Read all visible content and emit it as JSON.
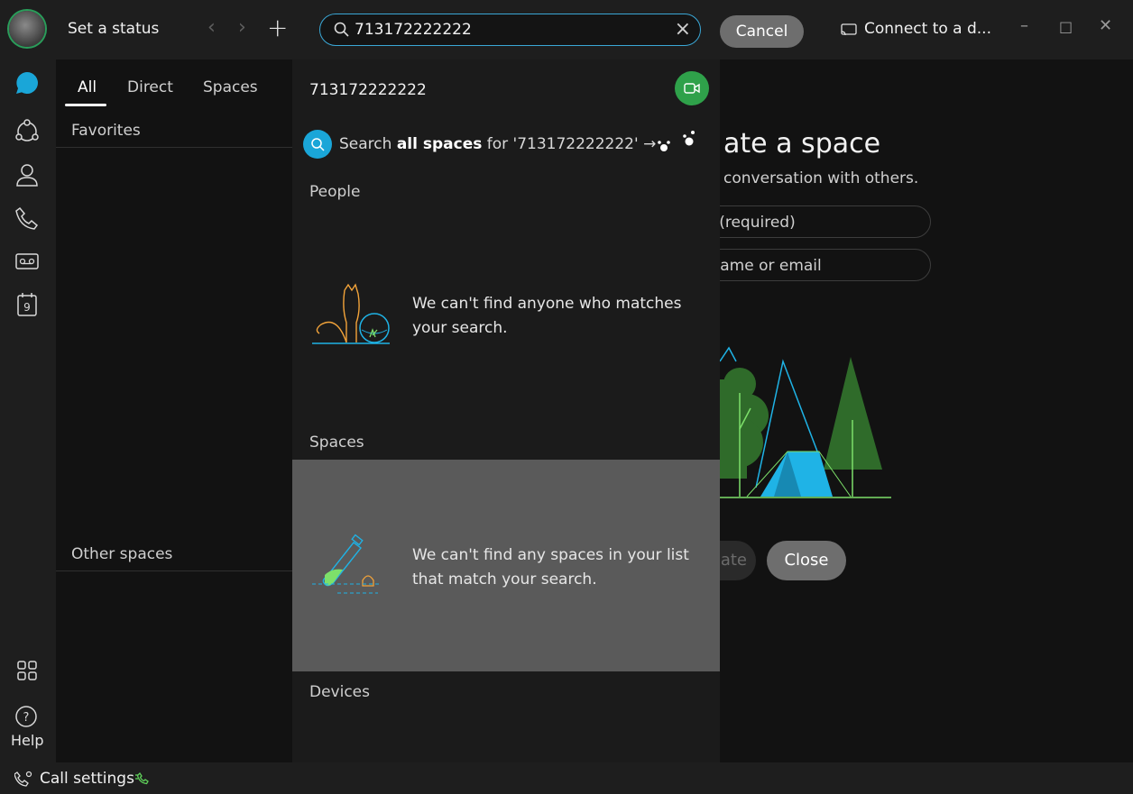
{
  "topbar": {
    "status_label": "Set a status",
    "search_value": "713172222222",
    "cancel_label": "Cancel",
    "connect_label": "Connect to a d...",
    "icons": [
      "back-icon",
      "forward-icon",
      "plus-icon",
      "search-icon",
      "clear-icon",
      "cast-icon",
      "minimize-icon",
      "maximize-icon",
      "close-icon"
    ]
  },
  "rail": {
    "help_label": "Help",
    "calendar_day": "9",
    "icons": [
      "messaging-icon",
      "teams-icon",
      "contacts-icon",
      "calls-icon",
      "voicemail-icon",
      "calendar-icon",
      "apps-icon",
      "help-icon"
    ]
  },
  "listpane": {
    "tabs": [
      {
        "label": "All"
      },
      {
        "label": "Direct"
      },
      {
        "label": "Spaces"
      }
    ],
    "favorites_label": "Favorites",
    "other_spaces_label": "Other spaces"
  },
  "dropdown": {
    "query": "713172222222",
    "search_all_prefix": "Search ",
    "search_all_bold": "all spaces",
    "search_all_suffix": " for '713172222222' →",
    "people_heading": "People",
    "people_empty": "We can't find anyone who matches your search.",
    "spaces_heading": "Spaces",
    "spaces_empty": "We can't find any spaces in your list that match your search.",
    "devices_heading": "Devices"
  },
  "main": {
    "title": "ate a space",
    "subtitle": "conversation with others.",
    "space_name_placeholder": "ce (required)",
    "people_placeholder": "y name or email",
    "create_label": "ate",
    "close_label": "Close"
  },
  "bottombar": {
    "call_settings_label": "Call settings"
  },
  "colors": {
    "accent_blue": "#1aa6d8",
    "video_green": "#2fa14a",
    "tent_blue": "#1fb3e6",
    "tree_green": "#2f6b2a"
  }
}
